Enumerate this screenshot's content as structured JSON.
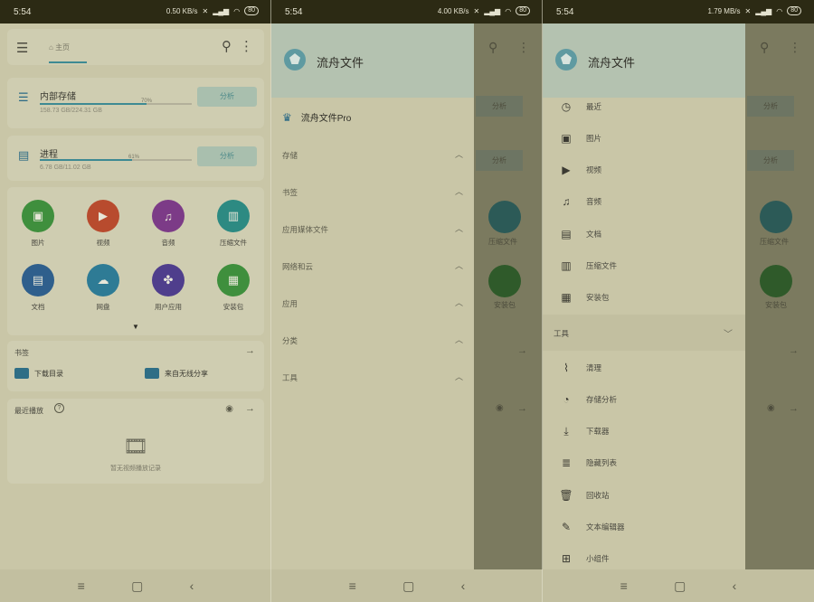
{
  "status": {
    "time": "5:54",
    "battery": "80",
    "net1": "0.50 KB/s",
    "net2": "4.00 KB/s",
    "net3": "1.79 MB/s"
  },
  "home": {
    "breadcrumb": "主页",
    "storage": [
      {
        "title": "内部存储",
        "percent": 70,
        "percent_label": "70%",
        "sub": "158.73 GB/224.31 GB",
        "button": "分析"
      },
      {
        "title": "进程",
        "percent": 61,
        "percent_label": "61%",
        "sub": "6.78 GB/11.02 GB",
        "button": "分析"
      }
    ],
    "categories": [
      {
        "label": "图片",
        "color": "#3f8f3d",
        "icon": "image-icon"
      },
      {
        "label": "视频",
        "color": "#b84b2e",
        "icon": "video-icon"
      },
      {
        "label": "音频",
        "color": "#7c3b87",
        "icon": "headphones-icon"
      },
      {
        "label": "压缩文件",
        "color": "#2d8a82",
        "icon": "archive-icon"
      },
      {
        "label": "文档",
        "color": "#2f5f8c",
        "icon": "document-icon"
      },
      {
        "label": "网盘",
        "color": "#2e7b95",
        "icon": "cloud-icon"
      },
      {
        "label": "用户应用",
        "color": "#4f3e8c",
        "icon": "apps-icon"
      },
      {
        "label": "安装包",
        "color": "#3f8f3d",
        "icon": "android-icon"
      }
    ],
    "bookmarks": {
      "title": "书签",
      "items": [
        "下载目录",
        "来自无线分享"
      ]
    },
    "recent": {
      "title": "最近播放",
      "empty": "暂无视频播放记录"
    }
  },
  "drawer": {
    "app_name": "流舟文件",
    "pro_label": "流舟文件Pro",
    "sections": [
      "存储",
      "书签",
      "应用媒体文件",
      "网络和云",
      "应用",
      "分类",
      "工具"
    ],
    "category_items": [
      {
        "label": "最近",
        "icon": "clock-icon"
      },
      {
        "label": "图片",
        "icon": "image-icon"
      },
      {
        "label": "视频",
        "icon": "video-icon"
      },
      {
        "label": "音频",
        "icon": "headphones-icon"
      },
      {
        "label": "文档",
        "icon": "document-icon"
      },
      {
        "label": "压缩文件",
        "icon": "archive-icon"
      },
      {
        "label": "安装包",
        "icon": "package-icon"
      }
    ],
    "tools_header": "工具",
    "tool_items": [
      {
        "label": "清理",
        "icon": "broom-icon"
      },
      {
        "label": "存储分析",
        "icon": "pie-chart-icon"
      },
      {
        "label": "下载器",
        "icon": "download-icon"
      },
      {
        "label": "隐藏列表",
        "icon": "hidden-list-icon"
      },
      {
        "label": "回收站",
        "icon": "trash-icon"
      },
      {
        "label": "文本编辑器",
        "icon": "text-editor-icon"
      },
      {
        "label": "小组件",
        "icon": "widgets-icon"
      }
    ]
  },
  "ghost": {
    "archive": "压缩文件",
    "apk": "安装包",
    "analyze": "分析"
  }
}
